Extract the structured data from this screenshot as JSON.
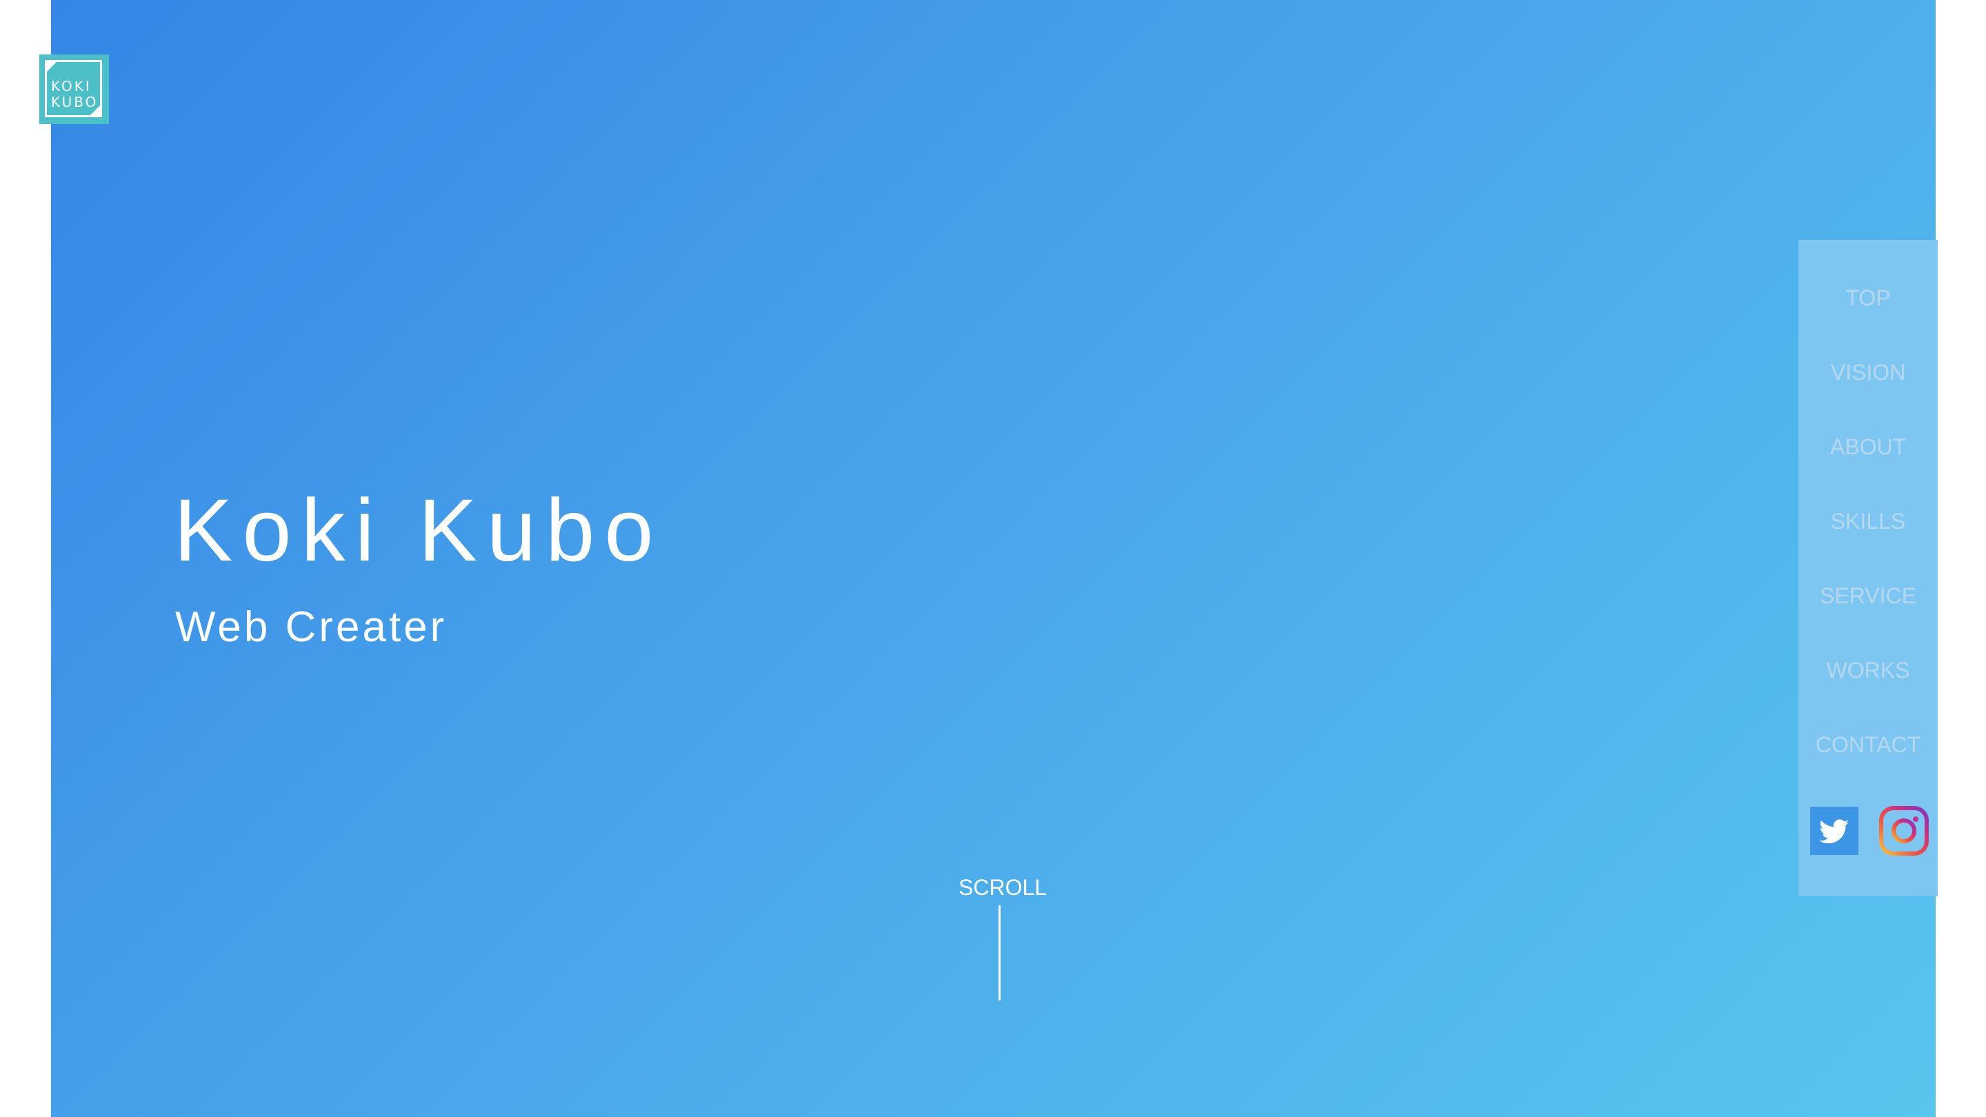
{
  "logo": {
    "line1": "KOKI",
    "line2": "KUBO",
    "color": "#4bc0c8"
  },
  "hero": {
    "title": "Koki Kubo",
    "subtitle": "Web Creater",
    "gradient_start": "#3586e6",
    "gradient_end": "#56c6ee"
  },
  "scroll": {
    "label": "SCROLL"
  },
  "nav": {
    "items": [
      {
        "label": "TOP"
      },
      {
        "label": "VISION"
      },
      {
        "label": "ABOUT"
      },
      {
        "label": "SKILLS"
      },
      {
        "label": "SERVICE"
      },
      {
        "label": "WORKS"
      },
      {
        "label": "CONTACT"
      }
    ],
    "social": [
      {
        "icon": "twitter-icon"
      },
      {
        "icon": "instagram-icon"
      }
    ]
  }
}
